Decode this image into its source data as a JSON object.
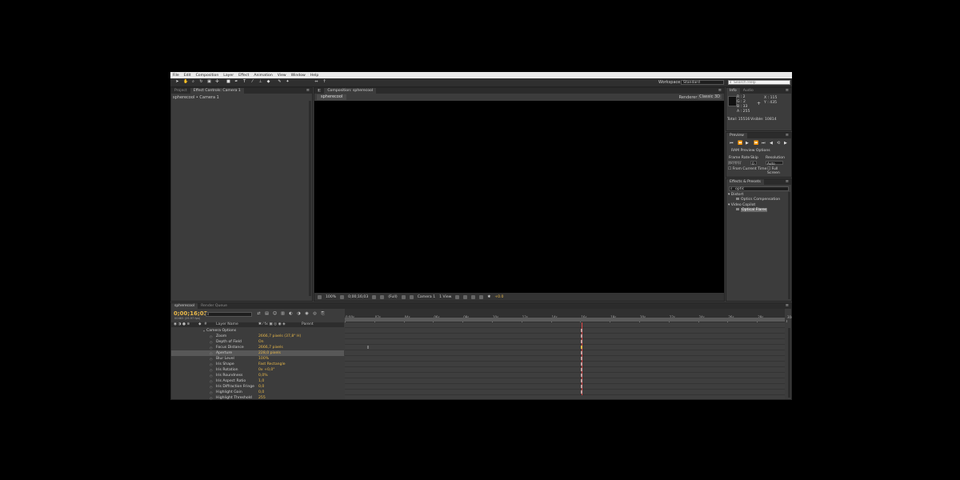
{
  "menu": [
    "File",
    "Edit",
    "Composition",
    "Layer",
    "Effect",
    "Animation",
    "View",
    "Window",
    "Help"
  ],
  "toolbar": {
    "workspace_label": "Workspace:",
    "workspace_value": "Standard",
    "search_placeholder": "Search Help"
  },
  "project_panel": {
    "tabs": [
      "Project",
      "Effect Controls: Camera 1"
    ],
    "title": "spherecool • Camera 1"
  },
  "comp_panel": {
    "tab": "Composition: spherecool",
    "subtab": "spherecool",
    "renderer_label": "Renderer:",
    "renderer_value": "Classic 3D",
    "zoom": "100%",
    "timecode": "0;00;16;03",
    "quality": "(Full)",
    "camera": "Camera 1",
    "view": "1 View",
    "exposure": "+0.0"
  },
  "info_panel": {
    "tabs": [
      "Info",
      "Audio"
    ],
    "r": "R : 2",
    "g": "G : 2",
    "b": "B : 33",
    "a": "A : 255",
    "x": "X : 115",
    "y": "Y : 435",
    "total": "Total: 15516",
    "visible": "Visible: 10814"
  },
  "preview_panel": {
    "tab": "Preview",
    "ram_options": "RAM Preview Options",
    "frame_rate_label": "Frame Rate",
    "skip_label": "Skip",
    "resolution_label": "Resolution",
    "frame_rate_value": "(29.97)",
    "skip_value": "0",
    "resolution_value": "Auto",
    "from_current": "From Current Time",
    "full_screen": "Full Screen"
  },
  "effects_panel": {
    "tab": "Effects & Presets",
    "search_value": "optic",
    "groups": [
      {
        "name": "Distort",
        "items": [
          "Optics Compensation"
        ]
      },
      {
        "name": "Video Copilot",
        "items": [
          "Optical Flares"
        ]
      }
    ]
  },
  "timeline": {
    "tabs": [
      "spherecool",
      "Render Queue"
    ],
    "timecode": "0;00;16;03",
    "fps": "00483 (29.97 fps)",
    "columns": {
      "layer_name": "Layer Name",
      "parent": "Parent"
    },
    "rows": [
      {
        "name": "Camera Options",
        "value": "",
        "indent": 0
      },
      {
        "name": "Zoom",
        "value": "2666,7 pixels (37,8° H)",
        "indent": 1
      },
      {
        "name": "Depth of Field",
        "value": "On",
        "indent": 1
      },
      {
        "name": "Focus Distance",
        "value": "2666,7 pixels",
        "indent": 1
      },
      {
        "name": "Aperture",
        "value": "228,0 pixels",
        "indent": 1,
        "selected": true
      },
      {
        "name": "Blur Level",
        "value": "100%",
        "indent": 1
      },
      {
        "name": "Iris Shape",
        "value": "Fast Rectangle",
        "indent": 1
      },
      {
        "name": "Iris Rotation",
        "value": "0x +0,0°",
        "indent": 1
      },
      {
        "name": "Iris Roundness",
        "value": "0,0%",
        "indent": 1
      },
      {
        "name": "Iris Aspect Ratio",
        "value": "1,0",
        "indent": 1
      },
      {
        "name": "Iris Diffraction Fringe",
        "value": "0,0",
        "indent": 1
      },
      {
        "name": "Highlight Gain",
        "value": "0,0",
        "indent": 1
      },
      {
        "name": "Highlight Threshold",
        "value": "255",
        "indent": 1
      }
    ],
    "ruler_labels": [
      "0;00s",
      "02s",
      "04s",
      "06s",
      "08s",
      "10s",
      "12s",
      "14s",
      "16s",
      "18s",
      "20s",
      "22s",
      "24s",
      "26s",
      "28s",
      "30s"
    ],
    "duration_seconds": 30,
    "current_time_seconds": 16.1,
    "keyframe_time_seconds": 1.6
  }
}
